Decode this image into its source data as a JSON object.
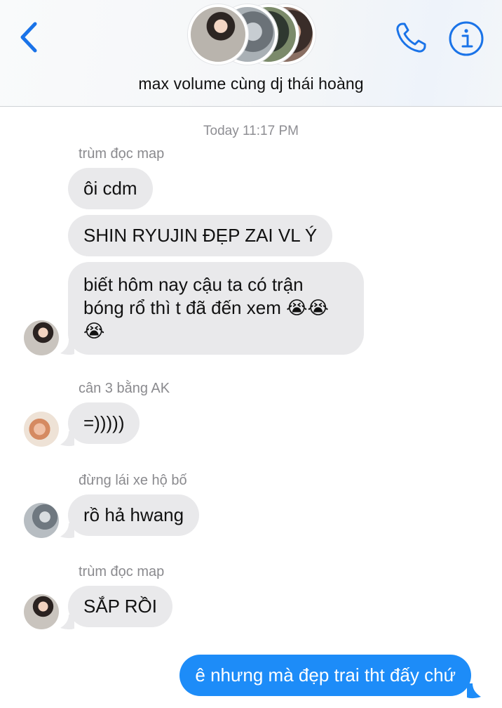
{
  "header": {
    "group_title": "max volume cùng dj thái hoàng",
    "accent_color": "#1a73e8",
    "icons": [
      "back-chevron-icon",
      "phone-icon",
      "info-icon"
    ]
  },
  "timestamp": "Today 11:17 PM",
  "messages": [
    {
      "sender": "trùm đọc map",
      "bubbles": [
        "ôi cdm",
        "SHIN RYUJIN ĐẸP ZAI VL Ý",
        "biết hôm nay cậu ta có trận bóng rổ thì t đã đến xem 😭😭😭"
      ]
    },
    {
      "sender": "cân 3 bằng AK",
      "bubbles": [
        "=)))))"
      ]
    },
    {
      "sender": "đừng lái xe hộ bố",
      "bubbles": [
        "rồ hả hwang"
      ]
    },
    {
      "sender": "trùm đọc map",
      "bubbles": [
        "SẮP RỒI"
      ]
    },
    {
      "sender": "me",
      "bubbles": [
        "ê nhưng mà đẹp trai tht đấy chứ"
      ]
    }
  ],
  "colors": {
    "incoming_bubble": "#e9e9eb",
    "outgoing_bubble": "#1d8cf8"
  }
}
